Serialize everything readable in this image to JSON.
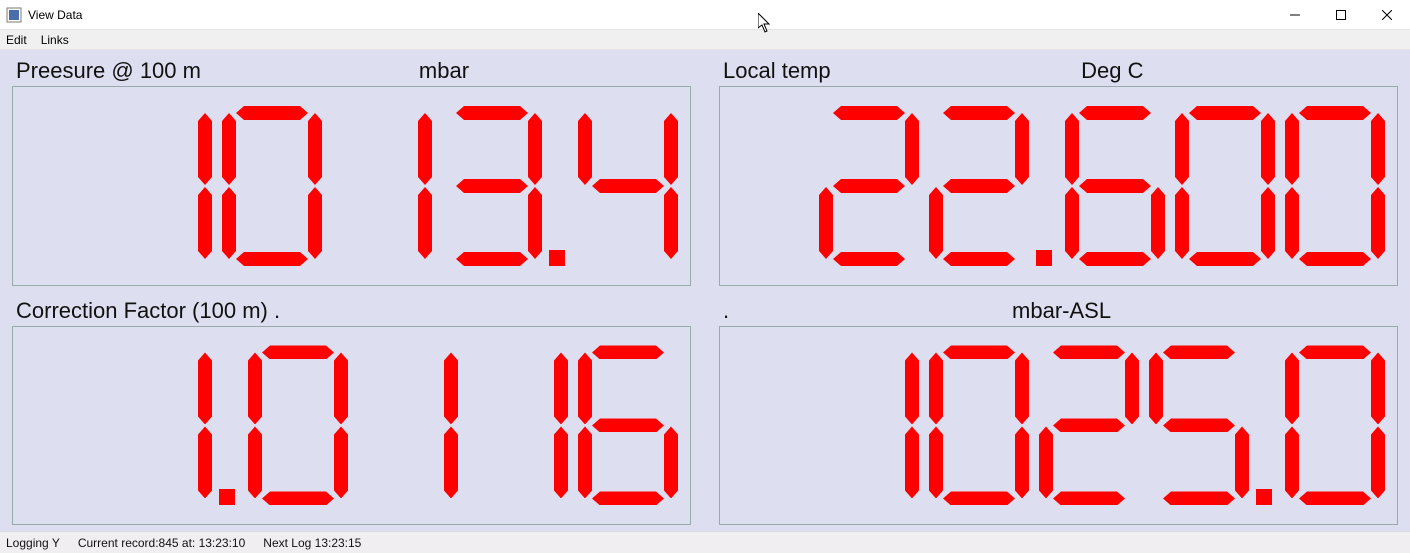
{
  "window": {
    "title": "View Data"
  },
  "menu": {
    "items": [
      "Edit",
      "Links"
    ]
  },
  "panels": [
    {
      "name": "Preesure @ 100 m",
      "unit": "mbar",
      "value": "1013.4"
    },
    {
      "name": "Local temp",
      "unit": "Deg C",
      "value": "22.600"
    },
    {
      "name": "Correction Factor (100 m) .",
      "unit": "",
      "value": "1.0116"
    },
    {
      "name": ".",
      "unit": "mbar-ASL",
      "value": "1025.0"
    }
  ],
  "status": {
    "logging": "Logging Y",
    "current_record": "Current record:845 at: 13:23:10",
    "next_log": "Next Log 13:23:15"
  }
}
